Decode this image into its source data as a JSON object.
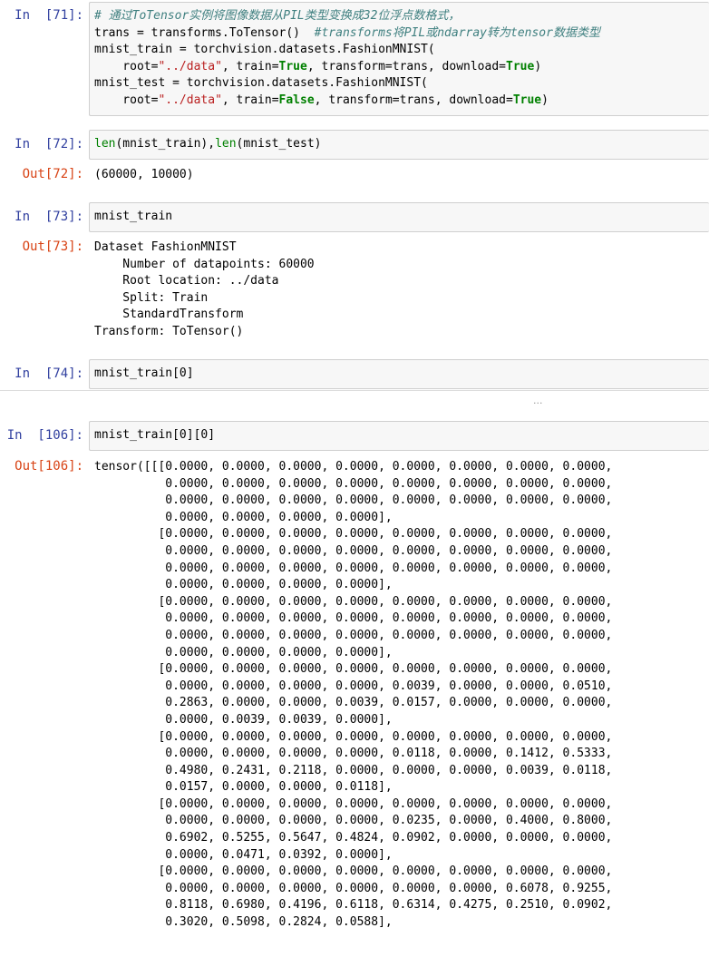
{
  "cells": {
    "c71": {
      "prompt": "In  [71]:",
      "line1_comment": "# 通过ToTensor实例将图像数据从PIL类型变换成32位浮点数格式，",
      "line2_code": "trans = transforms.ToTensor()  ",
      "line2_comment": "#transforms将PIL或ndarray转为tensor数据类型",
      "line3_a": "mnist_train = torchvision.datasets.FashionMNIST(",
      "line4_a": "    root=",
      "line4_str": "\"../data\"",
      "line4_b": ", train=",
      "line4_kw1": "True",
      "line4_c": ", transform=trans, download=",
      "line4_kw2": "True",
      "line4_d": ")",
      "line5_a": "mnist_test = torchvision.datasets.FashionMNIST(",
      "line6_a": "    root=",
      "line6_str": "\"../data\"",
      "line6_b": ", train=",
      "line6_kw1": "False",
      "line6_c": ", transform=trans, download=",
      "line6_kw2": "True",
      "line6_d": ")"
    },
    "c72": {
      "prompt": "In  [72]:",
      "fn1": "len",
      "arg1": "(mnist_train),",
      "fn2": "len",
      "arg2": "(mnist_test)",
      "out_prompt": "Out[72]:",
      "output": "(60000, 10000)"
    },
    "c73": {
      "prompt": "In  [73]:",
      "code": "mnist_train",
      "out_prompt": "Out[73]:",
      "output": "Dataset FashionMNIST\n    Number of datapoints: 60000\n    Root location: ../data\n    Split: Train\n    StandardTransform\nTransform: ToTensor()"
    },
    "c74": {
      "prompt": "In  [74]:",
      "code": "mnist_train[0]",
      "collapsed": "..."
    },
    "c106": {
      "prompt": "In  [106]:",
      "code": "mnist_train[0][0]",
      "out_prompt": "Out[106]:",
      "output": "tensor([[[0.0000, 0.0000, 0.0000, 0.0000, 0.0000, 0.0000, 0.0000, 0.0000,\n          0.0000, 0.0000, 0.0000, 0.0000, 0.0000, 0.0000, 0.0000, 0.0000,\n          0.0000, 0.0000, 0.0000, 0.0000, 0.0000, 0.0000, 0.0000, 0.0000,\n          0.0000, 0.0000, 0.0000, 0.0000],\n         [0.0000, 0.0000, 0.0000, 0.0000, 0.0000, 0.0000, 0.0000, 0.0000,\n          0.0000, 0.0000, 0.0000, 0.0000, 0.0000, 0.0000, 0.0000, 0.0000,\n          0.0000, 0.0000, 0.0000, 0.0000, 0.0000, 0.0000, 0.0000, 0.0000,\n          0.0000, 0.0000, 0.0000, 0.0000],\n         [0.0000, 0.0000, 0.0000, 0.0000, 0.0000, 0.0000, 0.0000, 0.0000,\n          0.0000, 0.0000, 0.0000, 0.0000, 0.0000, 0.0000, 0.0000, 0.0000,\n          0.0000, 0.0000, 0.0000, 0.0000, 0.0000, 0.0000, 0.0000, 0.0000,\n          0.0000, 0.0000, 0.0000, 0.0000],\n         [0.0000, 0.0000, 0.0000, 0.0000, 0.0000, 0.0000, 0.0000, 0.0000,\n          0.0000, 0.0000, 0.0000, 0.0000, 0.0039, 0.0000, 0.0000, 0.0510,\n          0.2863, 0.0000, 0.0000, 0.0039, 0.0157, 0.0000, 0.0000, 0.0000,\n          0.0000, 0.0039, 0.0039, 0.0000],\n         [0.0000, 0.0000, 0.0000, 0.0000, 0.0000, 0.0000, 0.0000, 0.0000,\n          0.0000, 0.0000, 0.0000, 0.0000, 0.0118, 0.0000, 0.1412, 0.5333,\n          0.4980, 0.2431, 0.2118, 0.0000, 0.0000, 0.0000, 0.0039, 0.0118,\n          0.0157, 0.0000, 0.0000, 0.0118],\n         [0.0000, 0.0000, 0.0000, 0.0000, 0.0000, 0.0000, 0.0000, 0.0000,\n          0.0000, 0.0000, 0.0000, 0.0000, 0.0235, 0.0000, 0.4000, 0.8000,\n          0.6902, 0.5255, 0.5647, 0.4824, 0.0902, 0.0000, 0.0000, 0.0000,\n          0.0000, 0.0471, 0.0392, 0.0000],\n         [0.0000, 0.0000, 0.0000, 0.0000, 0.0000, 0.0000, 0.0000, 0.0000,\n          0.0000, 0.0000, 0.0000, 0.0000, 0.0000, 0.0000, 0.6078, 0.9255,\n          0.8118, 0.6980, 0.4196, 0.6118, 0.6314, 0.4275, 0.2510, 0.0902,\n          0.3020, 0.5098, 0.2824, 0.0588],"
    }
  },
  "colors": {
    "in_prompt": "#303F9F",
    "out_prompt": "#D84315",
    "input_bg": "#f7f7f7",
    "keyword": "#008000",
    "string": "#BA2121",
    "comment": "#408080"
  }
}
